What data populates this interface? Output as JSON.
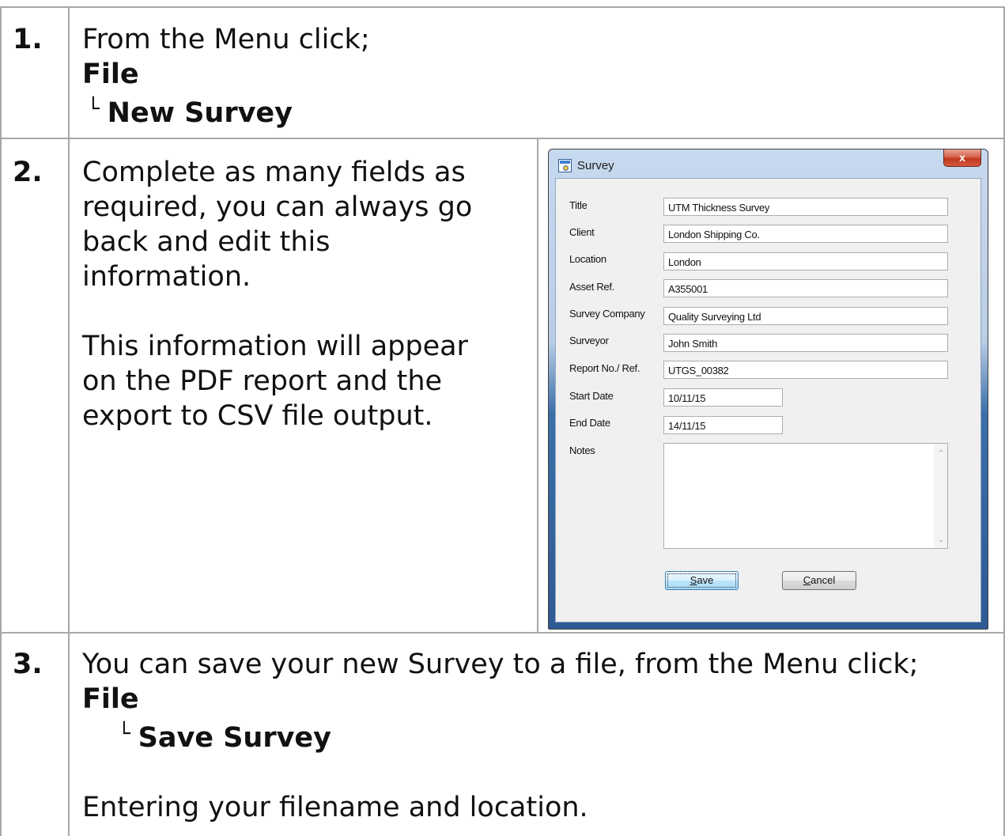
{
  "steps": [
    {
      "number": "1.",
      "lines": [
        "From the Menu click;"
      ],
      "menu": "File",
      "submenu": "New Survey"
    },
    {
      "number": "2.",
      "paragraph1": [
        "Complete as many fields as",
        "required, you can always go",
        "back and edit this",
        "information."
      ],
      "paragraph2": [
        "This information will appear",
        "on the PDF report and the",
        "export to CSV file output."
      ]
    },
    {
      "number": "3.",
      "lines": [
        "You can save your new Survey to a file, from the Menu click;"
      ],
      "menu": "File",
      "submenu": "Save Survey",
      "footer": "Entering your filename and location."
    }
  ],
  "tree_glyph": "└",
  "dialog": {
    "title": "Survey",
    "close_label": "x",
    "fields": [
      {
        "label": "Title",
        "value": "UTM Thickness Survey"
      },
      {
        "label": "Client",
        "value": "London Shipping Co."
      },
      {
        "label": "Location",
        "value": "London"
      },
      {
        "label": "Asset Ref.",
        "value": "A355001"
      },
      {
        "label": "Survey Company",
        "value": "Quality Surveying Ltd"
      },
      {
        "label": "Surveyor",
        "value": "John Smith"
      },
      {
        "label": "Report No./ Ref.",
        "value": "UTGS_00382"
      },
      {
        "label": "Start Date",
        "value": "10/11/15"
      },
      {
        "label": "End Date",
        "value": "14/11/15"
      }
    ],
    "notes_label": "Notes",
    "notes_value": "",
    "save_mnemonic": "S",
    "save_rest": "ave",
    "cancel_mnemonic": "C",
    "cancel_rest": "ancel"
  },
  "colors": {
    "grid": "#a8a8a8",
    "dialog_frame": "#2e5a93",
    "close_button": "#c0391f"
  }
}
